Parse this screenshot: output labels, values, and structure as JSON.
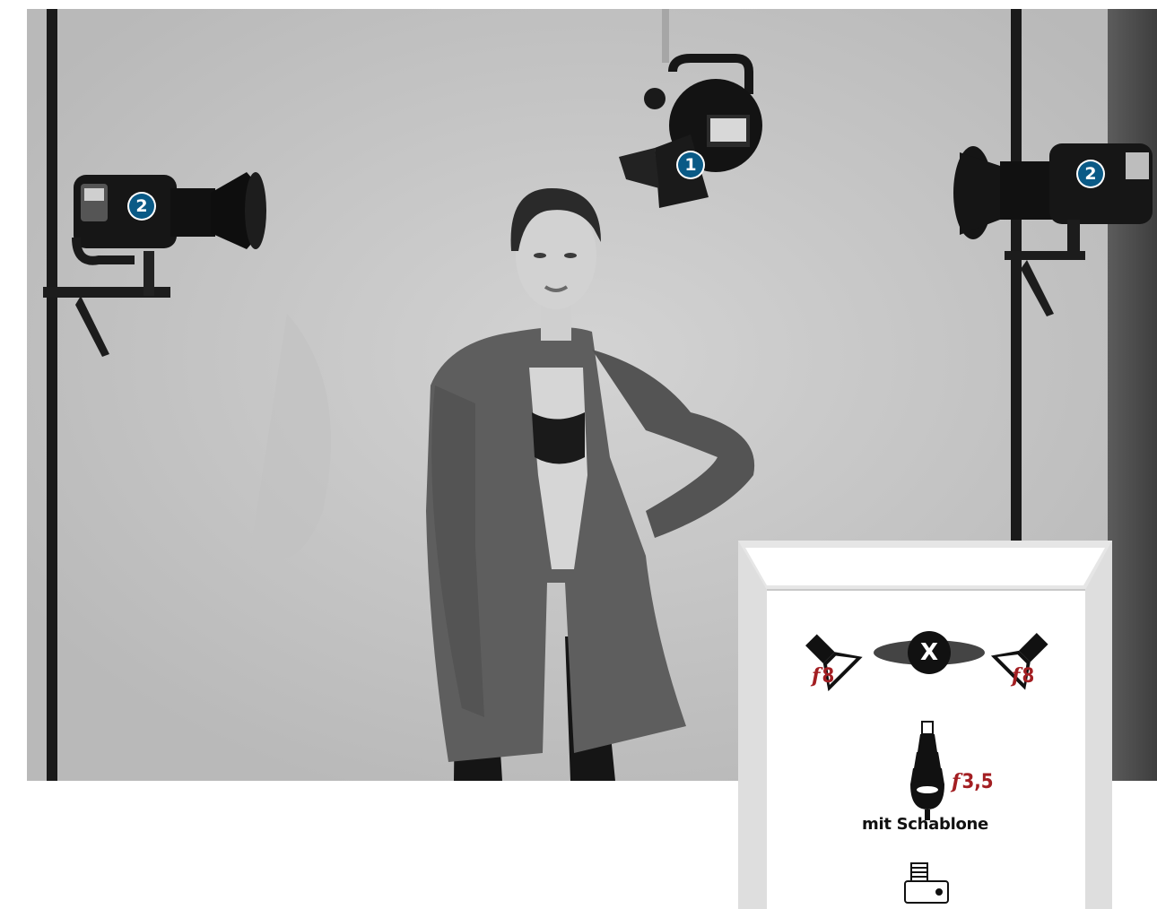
{
  "photo": {
    "badges": [
      {
        "label": "1"
      },
      {
        "label": "2"
      },
      {
        "label": "2"
      }
    ]
  },
  "diagram": {
    "left_light_fstop": "8",
    "right_light_fstop": "8",
    "subject_marker": "X",
    "spot_fstop": "3,5",
    "spot_note": "mit Schablone",
    "fstop_prefix": "f",
    "fstop_color": "#a31e22"
  }
}
